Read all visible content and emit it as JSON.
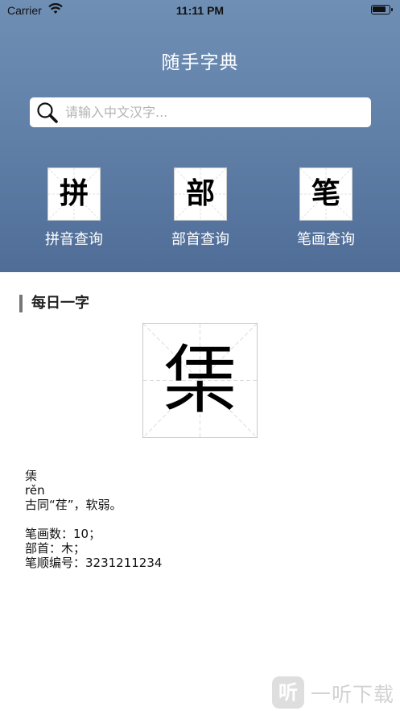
{
  "status_bar": {
    "carrier": "Carrier",
    "time": "11:11 PM"
  },
  "app": {
    "title": "随手字典"
  },
  "search": {
    "placeholder": "请输入中文汉字..."
  },
  "quick_actions": [
    {
      "glyph": "拼",
      "label": "拼音查询"
    },
    {
      "glyph": "部",
      "label": "部首查询"
    },
    {
      "glyph": "笔",
      "label": "笔画查询"
    }
  ],
  "daily": {
    "section_title": "每日一字",
    "character": "栠",
    "char_line": "栠",
    "pinyin": "rěn",
    "meaning": "古同“荏”，软弱。",
    "strokes": "笔画数：10；",
    "radical": "部首：木；",
    "stroke_order": "笔顺编号：3231211234"
  },
  "watermark": {
    "logo": "听",
    "text": "一听下载"
  }
}
